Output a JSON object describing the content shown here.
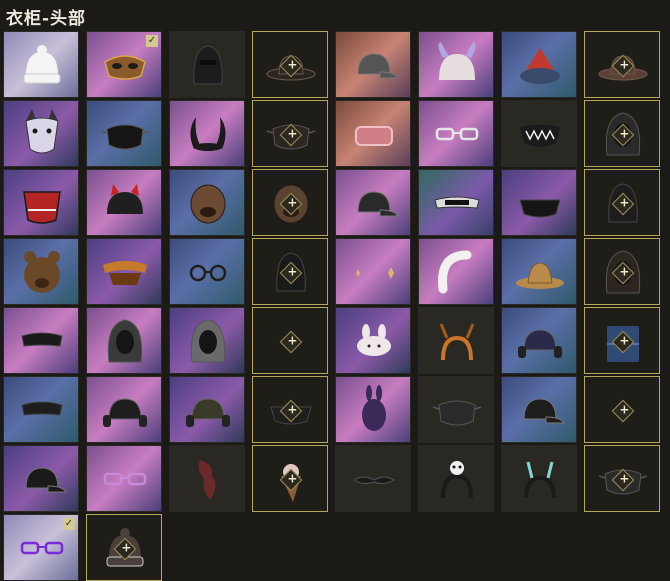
{
  "title": "衣柜-头部",
  "icons": {
    "check": "✓"
  },
  "slots": [
    {
      "name": "white-beanie",
      "bg": "white",
      "icon": "beanie",
      "color": "#f4f4f4",
      "locked": false,
      "checked": false
    },
    {
      "name": "gold-mask",
      "bg": "pink",
      "icon": "mask",
      "color": "#8b5a2b",
      "locked": false,
      "checked": true
    },
    {
      "name": "black-balaclava",
      "bg": "dark",
      "icon": "balaclava",
      "color": "#1c1c1c",
      "locked": false,
      "checked": false
    },
    {
      "name": "brown-fedora",
      "bg": "dark",
      "icon": "fedora",
      "color": "#2b2520",
      "locked": true,
      "checked": false
    },
    {
      "name": "grey-cap",
      "bg": "orange",
      "icon": "cap",
      "color": "#555555",
      "locked": false,
      "checked": false
    },
    {
      "name": "horned-hat",
      "bg": "pink",
      "icon": "horned",
      "color": "#e6dede",
      "locked": false,
      "checked": false
    },
    {
      "name": "red-fur-hat",
      "bg": "blue",
      "icon": "furhat",
      "color": "#c2392f",
      "locked": false,
      "checked": false
    },
    {
      "name": "brown-hat",
      "bg": "dark",
      "icon": "fedora",
      "color": "#5a3f34",
      "locked": true,
      "checked": false
    },
    {
      "name": "husky-mask",
      "bg": "purple",
      "icon": "husky",
      "color": "#d9d6e8",
      "locked": false,
      "checked": false
    },
    {
      "name": "black-face-mask",
      "bg": "blue",
      "icon": "facemask",
      "color": "#151515",
      "locked": false,
      "checked": false
    },
    {
      "name": "black-horns",
      "bg": "pink",
      "icon": "horns",
      "color": "#1a1a1a",
      "locked": false,
      "checked": false
    },
    {
      "name": "dark-mask",
      "bg": "dark",
      "icon": "facemask",
      "color": "#2c2520",
      "locked": true,
      "checked": false
    },
    {
      "name": "ham",
      "bg": "orange",
      "icon": "ham",
      "color": "#d07f86",
      "locked": false,
      "checked": false
    },
    {
      "name": "sunglasses",
      "bg": "pink",
      "icon": "glasses",
      "color": "#e6e6e6",
      "locked": false,
      "checked": false
    },
    {
      "name": "teeth-mask",
      "bg": "dark",
      "icon": "teeth",
      "color": "#1a1a1a",
      "locked": false,
      "checked": false
    },
    {
      "name": "hood",
      "bg": "dark",
      "icon": "hood",
      "color": "#2a2a2a",
      "locked": true,
      "checked": false
    },
    {
      "name": "red-oni-mask",
      "bg": "purple",
      "icon": "onimask",
      "color": "#b32424",
      "locked": false,
      "checked": false
    },
    {
      "name": "cat-cap",
      "bg": "pink",
      "icon": "catcap",
      "color": "#1f1f1f",
      "locked": false,
      "checked": false
    },
    {
      "name": "bulldog-head",
      "bg": "blue",
      "icon": "dog",
      "color": "#6b4b33",
      "locked": false,
      "checked": false
    },
    {
      "name": "wolf-head",
      "bg": "dark",
      "icon": "dog",
      "color": "#5a4330",
      "locked": true,
      "checked": false
    },
    {
      "name": "camo-cap",
      "bg": "pink",
      "icon": "cap",
      "color": "#2a2a2a",
      "locked": false,
      "checked": false
    },
    {
      "name": "sport-glasses",
      "bg": "green",
      "icon": "goggles",
      "color": "#dcdcdc",
      "locked": false,
      "checked": false
    },
    {
      "name": "black-bandana",
      "bg": "purple",
      "icon": "bandana",
      "color": "#151515",
      "locked": false,
      "checked": false
    },
    {
      "name": "dark-hood",
      "bg": "dark",
      "icon": "balaclava",
      "color": "#1d1d1d",
      "locked": true,
      "checked": false
    },
    {
      "name": "bear-head",
      "bg": "blue",
      "icon": "bear",
      "color": "#6b4828",
      "locked": false,
      "checked": false
    },
    {
      "name": "orange-visor",
      "bg": "purple",
      "icon": "visor",
      "color": "#c47a2a",
      "locked": false,
      "checked": false
    },
    {
      "name": "round-glasses",
      "bg": "blue",
      "icon": "roundglasses",
      "color": "#1e1e1e",
      "locked": false,
      "checked": false
    },
    {
      "name": "black-helmet",
      "bg": "dark",
      "icon": "balaclava",
      "color": "#1a1a1a",
      "locked": true,
      "checked": false
    },
    {
      "name": "sparkles",
      "bg": "pink",
      "icon": "sparkles",
      "color": "#d8b56b",
      "locked": false,
      "checked": false
    },
    {
      "name": "white-headband",
      "bg": "pink",
      "icon": "headband",
      "color": "#f3f0f0",
      "locked": false,
      "checked": false
    },
    {
      "name": "bucket-hat",
      "bg": "blue",
      "icon": "bucket",
      "color": "#b88b4a",
      "locked": false,
      "checked": false
    },
    {
      "name": "pouch",
      "bg": "dark",
      "icon": "hood",
      "color": "#2c2520",
      "locked": true,
      "checked": false
    },
    {
      "name": "black-eye-mask",
      "bg": "pink",
      "icon": "eyemask",
      "color": "#1a1a1a",
      "locked": false,
      "checked": false
    },
    {
      "name": "gas-mask-hood",
      "bg": "pink",
      "icon": "hood",
      "color": "#3a3a3a",
      "locked": false,
      "checked": false
    },
    {
      "name": "grey-hood",
      "bg": "purple",
      "icon": "hood",
      "color": "#6a6a6a",
      "locked": false,
      "checked": false
    },
    {
      "name": "red-diamond",
      "bg": "dark",
      "icon": "none",
      "color": "#b32424",
      "locked": true,
      "checked": false
    },
    {
      "name": "bunny-headband",
      "bg": "purple",
      "icon": "bunnyband",
      "color": "#f0e8e8",
      "locked": false,
      "checked": false
    },
    {
      "name": "antler-headband",
      "bg": "dark",
      "icon": "antlers",
      "color": "#c9752a",
      "locked": false,
      "checked": false
    },
    {
      "name": "headphones-cap",
      "bg": "blue",
      "icon": "headset",
      "color": "#2a2a4a",
      "locked": false,
      "checked": false
    },
    {
      "name": "denim-wrap",
      "bg": "dark",
      "icon": "denim",
      "color": "#2f4a75",
      "locked": true,
      "checked": false
    },
    {
      "name": "sleep-mask",
      "bg": "blue",
      "icon": "eyemask",
      "color": "#1e1e1e",
      "locked": false,
      "checked": false
    },
    {
      "name": "cap-headphones",
      "bg": "pink",
      "icon": "headset",
      "color": "#1e1e1e",
      "locked": false,
      "checked": false
    },
    {
      "name": "radio-headset",
      "bg": "purple",
      "icon": "headset",
      "color": "#3a3a2a",
      "locked": false,
      "checked": false
    },
    {
      "name": "dark-bandana",
      "bg": "dark",
      "icon": "bandana",
      "color": "#1e1e1e",
      "locked": true,
      "checked": false
    },
    {
      "name": "purple-rabbit-mask",
      "bg": "pink",
      "icon": "rabbitmask",
      "color": "#3a2a5a",
      "locked": false,
      "checked": false
    },
    {
      "name": "pattern-mask",
      "bg": "dark",
      "icon": "facemask",
      "color": "#2a2a2a",
      "locked": false,
      "checked": false
    },
    {
      "name": "black-cap",
      "bg": "blue",
      "icon": "cap",
      "color": "#1e1e1e",
      "locked": false,
      "checked": false
    },
    {
      "name": "empty-slot",
      "bg": "dark",
      "icon": "none",
      "color": "#1e1e1e",
      "locked": true,
      "checked": false
    },
    {
      "name": "black-cap-2",
      "bg": "purple",
      "icon": "cap",
      "color": "#1a1a1a",
      "locked": false,
      "checked": false
    },
    {
      "name": "pink-glasses",
      "bg": "pink",
      "icon": "glasses",
      "color": "#c98bd8",
      "locked": false,
      "checked": false
    },
    {
      "name": "red-scarf",
      "bg": "dark",
      "icon": "scarf",
      "color": "#6a2a2a",
      "locked": false,
      "checked": false
    },
    {
      "name": "ice-cream-hat",
      "bg": "dark",
      "icon": "cone",
      "color": "#8b5a3a",
      "locked": true,
      "checked": false
    },
    {
      "name": "mustache",
      "bg": "dark",
      "icon": "mustache",
      "color": "#1a1a1a",
      "locked": false,
      "checked": false
    },
    {
      "name": "panda-headband",
      "bg": "dark",
      "icon": "pandaband",
      "color": "#f0f0f0",
      "locked": false,
      "checked": false
    },
    {
      "name": "antenna-headband",
      "bg": "dark",
      "icon": "antenna",
      "color": "#7fd8d8",
      "locked": false,
      "checked": false
    },
    {
      "name": "black-mask",
      "bg": "dark",
      "icon": "facemask",
      "color": "#2a2a2a",
      "locked": true,
      "checked": false
    },
    {
      "name": "purple-sunglasses",
      "bg": "white",
      "icon": "glasses",
      "color": "#7a2ad8",
      "locked": false,
      "checked": true
    },
    {
      "name": "knit-cap",
      "bg": "dark",
      "icon": "beanie",
      "color": "#4a3f3a",
      "locked": true,
      "checked": false
    }
  ]
}
